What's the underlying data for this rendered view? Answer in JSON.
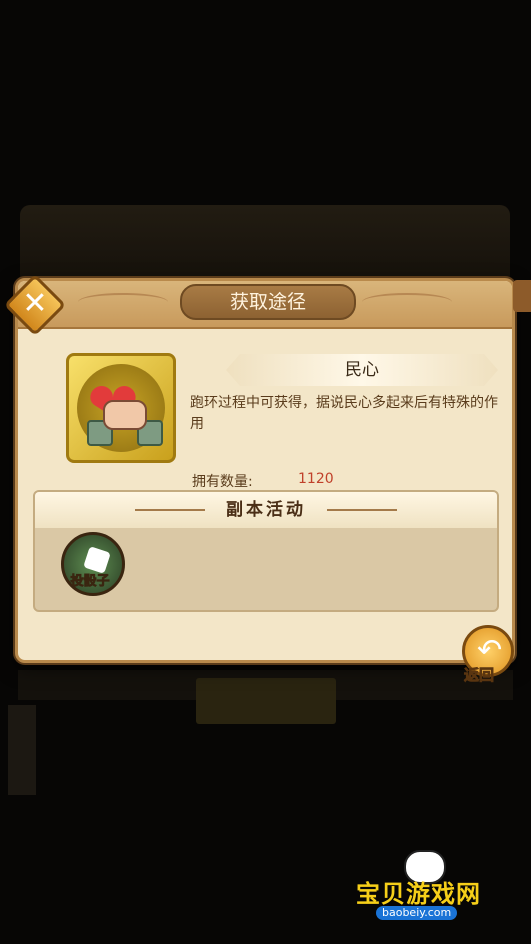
{
  "dialog": {
    "title": "获取途径",
    "item_name": "民心",
    "description": "跑环过程中可获得，据说民心多起来后有特殊的作用",
    "own_label": "拥有数量:",
    "own_value": "1120",
    "section_title": "副本活动",
    "activities": [
      {
        "label": "投骰子",
        "icon": "dice-icon"
      }
    ],
    "back_label": "返回",
    "close_icon": "close-icon"
  },
  "watermark": {
    "text": "宝贝游戏网",
    "url": "baobeiy.com"
  },
  "colors": {
    "dialog_bg": "#f3e6c8",
    "count_color": "#c0402a",
    "accent_gold": "#f6cf19"
  }
}
